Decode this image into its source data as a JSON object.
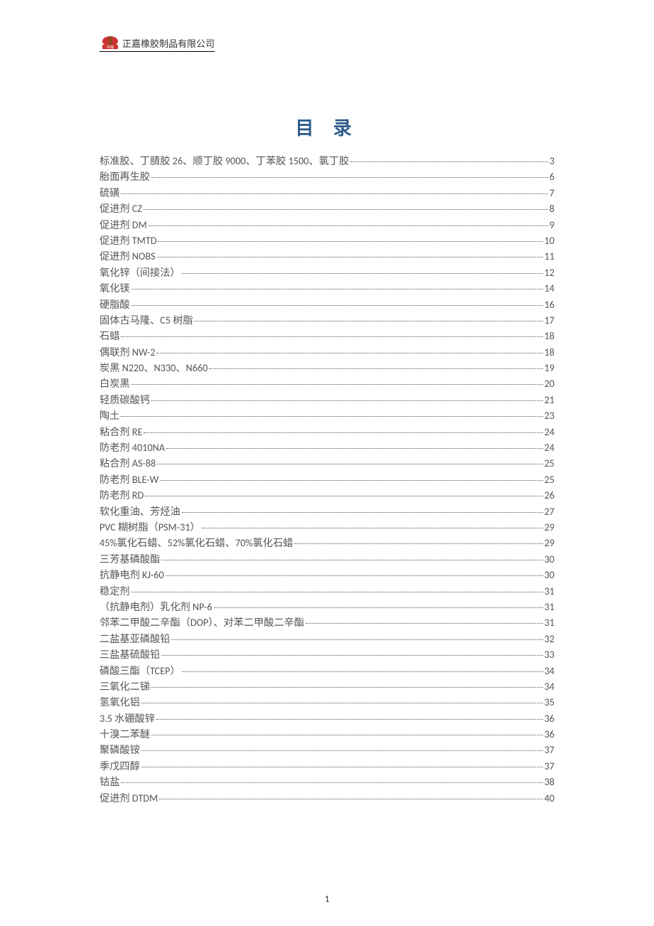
{
  "header": {
    "company": "正嘉橡胶制品有限公司"
  },
  "title": "目 录",
  "toc": [
    {
      "label": "标准胶、丁腈胶 26、顺丁胶 9000、丁苯胶 1500、氯丁胶",
      "page": "3"
    },
    {
      "label": "胎面再生胶",
      "page": "6"
    },
    {
      "label": "硫磺",
      "page": "7"
    },
    {
      "label": "促进剂 CZ",
      "page": "8"
    },
    {
      "label": "促进剂 DM",
      "page": "9"
    },
    {
      "label": "促进剂 TMTD",
      "page": "10"
    },
    {
      "label": "促进剂 NOBS",
      "page": "11"
    },
    {
      "label": "氧化锌（间接法）",
      "page": "12"
    },
    {
      "label": "氧化镁",
      "page": "14"
    },
    {
      "label": "硬脂酸",
      "page": "16"
    },
    {
      "label": "固体古马隆、C5 树脂",
      "page": "17"
    },
    {
      "label": "石蜡",
      "page": "18"
    },
    {
      "label": "偶联剂 NW-2",
      "page": "18"
    },
    {
      "label": "炭黑 N220、N330、N660",
      "page": "19"
    },
    {
      "label": "白炭黑",
      "page": "20"
    },
    {
      "label": "轻质碳酸钙",
      "page": "21"
    },
    {
      "label": "陶土",
      "page": "23"
    },
    {
      "label": "粘合剂 RE",
      "page": "24"
    },
    {
      "label": "防老剂 4010NA",
      "page": "24"
    },
    {
      "label": "粘合剂 AS-88",
      "page": "25"
    },
    {
      "label": "防老剂 BLE-W",
      "page": "25"
    },
    {
      "label": "防老剂 RD",
      "page": "26"
    },
    {
      "label": "软化重油、芳烃油",
      "page": "27"
    },
    {
      "label": "PVC 糊树脂（PSM-31）",
      "page": "29"
    },
    {
      "label": "45%氯化石蜡、52%氯化石蜡、70%氯化石蜡",
      "page": "29"
    },
    {
      "label": "三芳基磷酸酯",
      "page": "30"
    },
    {
      "label": "抗静电剂 KJ-60",
      "page": "30"
    },
    {
      "label": "稳定剂",
      "page": "31"
    },
    {
      "label": "（抗静电剂）乳化剂 NP-6",
      "page": "31"
    },
    {
      "label": "邻苯二甲酸二辛酯（DOP）、对苯二甲酸二辛酯",
      "page": "31"
    },
    {
      "label": "二盐基亚磷酸铅",
      "page": "32"
    },
    {
      "label": "三盐基硫酸铅",
      "page": "33"
    },
    {
      "label": "磷酸三酯（TCEP）",
      "page": "34"
    },
    {
      "label": "三氧化二锑",
      "page": "34"
    },
    {
      "label": "氢氧化铝",
      "page": "35"
    },
    {
      "label": "3.5 水硼酸锌",
      "page": "36"
    },
    {
      "label": "十溴二苯醚",
      "page": "36"
    },
    {
      "label": "聚磷酸铵",
      "page": "37"
    },
    {
      "label": "季戊四醇",
      "page": "37"
    },
    {
      "label": "钴盐",
      "page": "38"
    },
    {
      "label": "促进剂 DTDM",
      "page": "40"
    }
  ],
  "footer": {
    "page_number": "1"
  }
}
